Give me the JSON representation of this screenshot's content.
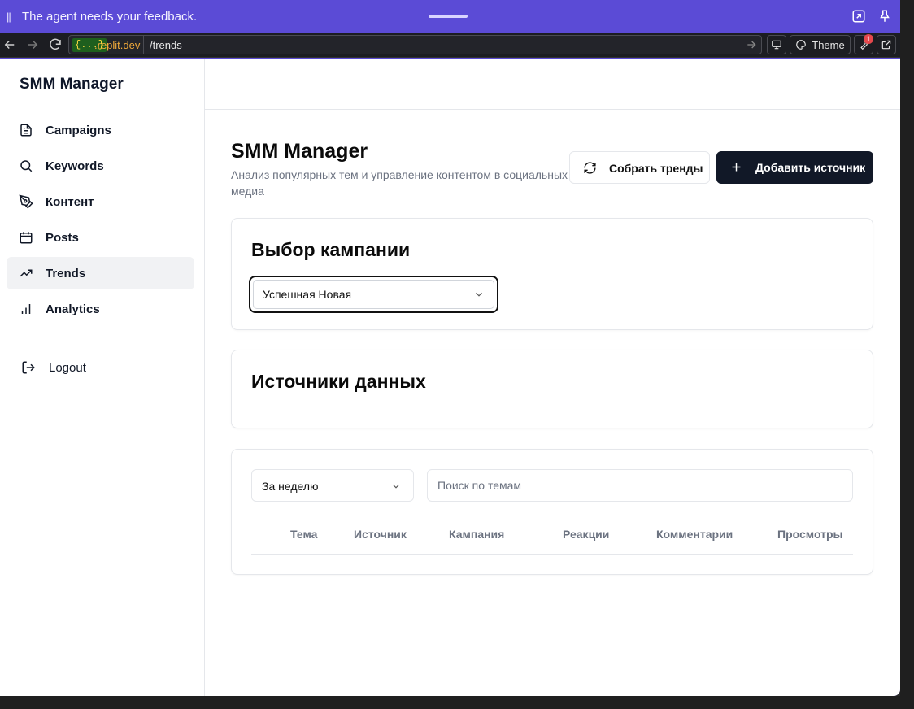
{
  "feedback_bar": {
    "message": "The agent needs your feedback."
  },
  "browser": {
    "url_badge": "{...}",
    "url_domain": ".replit.dev",
    "url_path": "/trends",
    "theme_label": "Theme",
    "notification_count": "1"
  },
  "sidebar": {
    "brand": "SMM Manager",
    "items": [
      {
        "label": "Campaigns",
        "icon": "file-text-icon"
      },
      {
        "label": "Keywords",
        "icon": "search-icon"
      },
      {
        "label": "Контент",
        "icon": "pen-tool-icon"
      },
      {
        "label": "Posts",
        "icon": "calendar-icon"
      },
      {
        "label": "Trends",
        "icon": "trending-up-icon",
        "active": true
      },
      {
        "label": "Analytics",
        "icon": "bar-chart-icon"
      }
    ],
    "logout_label": "Logout"
  },
  "header": {
    "title": "SMM Manager",
    "subtitle": "Анализ популярных тем и управление контентом в социальных медиа",
    "collect_button": "Собрать тренды",
    "add_source_button": "Добавить источник"
  },
  "campaign_card": {
    "title": "Выбор кампании",
    "selected_campaign": "Успешная Новая"
  },
  "sources_card": {
    "title": "Источники данных"
  },
  "trends_table": {
    "period": "За неделю",
    "search_placeholder": "Поиск по темам",
    "columns": [
      "Тема",
      "Источник",
      "Кампания",
      "Реакции",
      "Комментарии",
      "Просмотры"
    ]
  },
  "colors": {
    "accent": "#5b4bd6",
    "primary_button": "#111827",
    "active_nav": "#f1f2f4"
  }
}
